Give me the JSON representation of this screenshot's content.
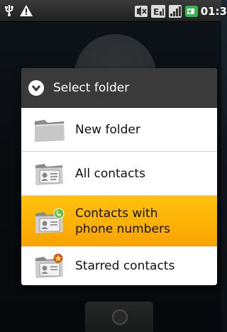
{
  "status_bar": {
    "icons_left": [
      "usb-icon",
      "warning-icon"
    ],
    "icons_right": [
      "vibrate-icon",
      "signal-e-icon",
      "signal-icon",
      "battery-icon"
    ],
    "clock": "01:3"
  },
  "dialog": {
    "title": "Select folder",
    "items": [
      {
        "label": "New folder",
        "icon": "folder-icon"
      },
      {
        "label": "All contacts",
        "icon": "contacts-folder-icon"
      },
      {
        "label": "Contacts with phone numbers",
        "label_line1": "Contacts with",
        "label_line2": "phone numbers",
        "icon": "contacts-phone-folder-icon",
        "selected": true
      },
      {
        "label": "Starred contacts",
        "icon": "starred-contacts-folder-icon"
      }
    ]
  },
  "colors": {
    "selected_bg": "#ffc20e",
    "title_bg": "#3a3a3a"
  }
}
